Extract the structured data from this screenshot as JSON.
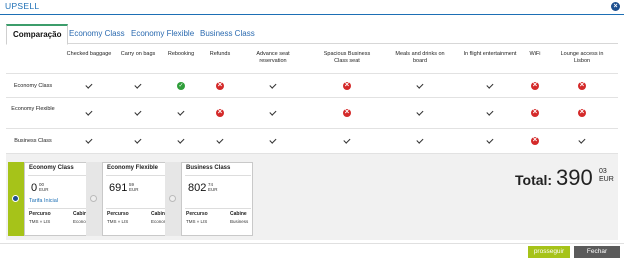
{
  "dialog": {
    "title": "UPSELL",
    "close_icon": "close-icon"
  },
  "tabs": [
    {
      "label": "Comparação",
      "active": true
    },
    {
      "label": "Economy Class",
      "active": false
    },
    {
      "label": "Economy Flexible",
      "active": false
    },
    {
      "label": "Business Class",
      "active": false
    }
  ],
  "comparison": {
    "columns": [
      "Checked baggage",
      "Carry on bags",
      "Rebooking",
      "Refunds",
      "Advance seat reservation",
      "Spacious Business Class seat",
      "Meals and drinks on board",
      "In flight entertainment",
      "WiFi",
      "Lounge access in Lisbon"
    ],
    "rows": [
      {
        "label": "Economy Class",
        "marks": [
          "check",
          "check",
          "green",
          "red",
          "check",
          "red",
          "check",
          "check",
          "red",
          "red"
        ]
      },
      {
        "label": "Economy Flexible",
        "marks": [
          "check",
          "check",
          "check",
          "red",
          "check",
          "red",
          "check",
          "check",
          "red",
          "red"
        ]
      },
      {
        "label": "Business Class",
        "marks": [
          "check",
          "check",
          "check",
          "check",
          "check",
          "check",
          "check",
          "check",
          "red",
          "check"
        ]
      }
    ]
  },
  "fare_cards": [
    {
      "title": "Economy Class",
      "price_int": "0",
      "price_cents": "00",
      "currency": "EUR",
      "tag": "Tarifa Inicial",
      "percurso_label": "Percurso",
      "percurso": "TMS » LIS",
      "cabine_label": "Cabine",
      "cabine": "Economy",
      "selected": true
    },
    {
      "title": "Economy Flexible",
      "price_int": "691",
      "price_cents": "59",
      "currency": "EUR",
      "tag": "",
      "percurso_label": "Percurso",
      "percurso": "TMS » LIS",
      "cabine_label": "Cabine",
      "cabine": "Economy",
      "selected": false
    },
    {
      "title": "Business Class",
      "price_int": "802",
      "price_cents": "74",
      "currency": "EUR",
      "tag": "",
      "percurso_label": "Percurso",
      "percurso": "TMS » LIS",
      "cabine_label": "Cabine",
      "cabine": "Business",
      "selected": false
    }
  ],
  "total": {
    "label": "Total:",
    "int": "390",
    "cents": "03",
    "currency": "EUR"
  },
  "buttons": {
    "proceed": "prosseguir",
    "close": "Fechar"
  },
  "colors": {
    "accent_green": "#a6c319",
    "link_blue": "#1d6fb5",
    "error_red": "#d42a2a",
    "ok_green": "#2f9e3a"
  }
}
